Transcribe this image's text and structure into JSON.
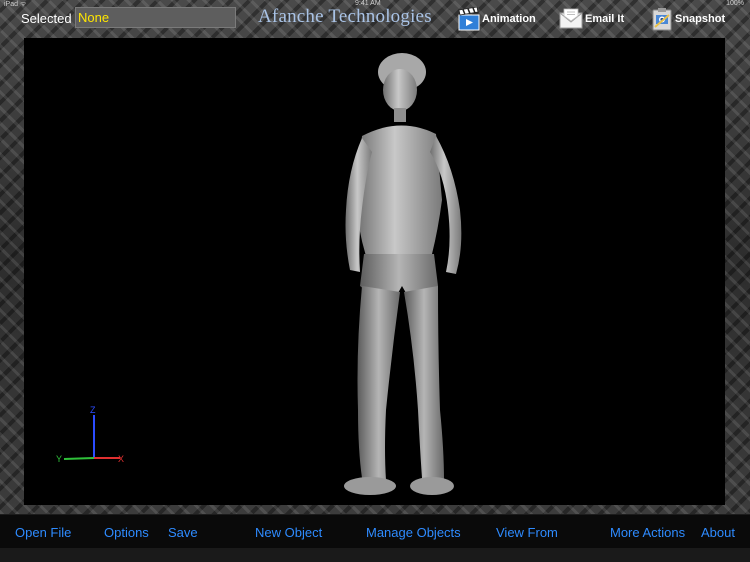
{
  "status": {
    "left": "iPad ᯤ",
    "time": "9:41 AM",
    "battery": "100%"
  },
  "selection": {
    "label": "Selected",
    "value": "None"
  },
  "brand": {
    "title": "Afanche Technologies"
  },
  "toolbar": {
    "animation_label": "Animation",
    "email_label": "Email It",
    "snapshot_label": "Snapshot"
  },
  "axis": {
    "x": "X",
    "y": "Y",
    "z": "Z"
  },
  "bottom_nav": {
    "open_file": "Open File",
    "options": "Options",
    "save": "Save",
    "new_object": "New Object",
    "manage_objects": "Manage Objects",
    "view_from": "View From",
    "more_actions": "More Actions",
    "about": "About"
  },
  "colors": {
    "accent": "#2e8bff",
    "selected_value": "#ffe600",
    "brand": "#a9c3e6",
    "axis_x": "#e03030",
    "axis_y": "#2fc23a",
    "axis_z": "#2b4cff"
  },
  "icons": [
    "clapperboard-icon",
    "envelope-icon",
    "camera-clipboard-icon"
  ]
}
